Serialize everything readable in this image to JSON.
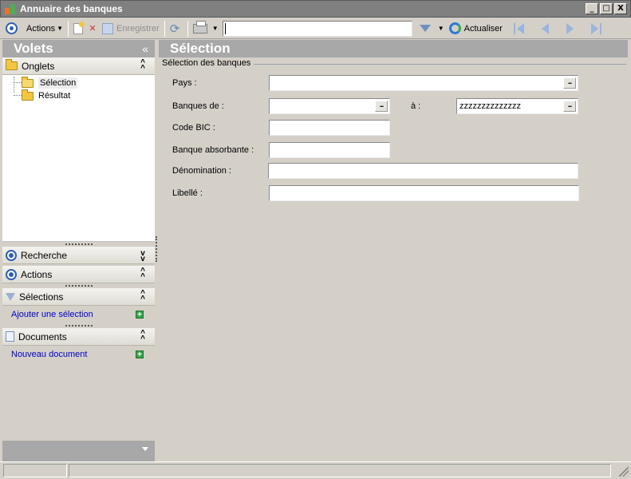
{
  "window": {
    "title": "Annuaire des banques",
    "controls": {
      "minimize": "_",
      "maximize": "□",
      "close": "X"
    }
  },
  "toolbar": {
    "actions_label": "Actions",
    "save_label": "Enregistrer",
    "search_value": "",
    "refresh_label": "Actualiser"
  },
  "left_pane": {
    "title": "Volets",
    "collapse_glyph": "«",
    "onglets": {
      "label": "Onglets",
      "items": [
        {
          "label": "Sélection",
          "selected": true
        },
        {
          "label": "Résultat",
          "selected": false
        }
      ]
    },
    "recherche": {
      "label": "Recherche"
    },
    "actions": {
      "label": "Actions"
    },
    "selections": {
      "label": "Sélections",
      "link": "Ajouter une sélection"
    },
    "documents": {
      "label": "Documents",
      "link": "Nouveau document"
    }
  },
  "right_pane": {
    "title": "Sélection",
    "group_title": "Sélection des banques",
    "fields": {
      "pays": {
        "label": "Pays :",
        "value": ""
      },
      "banques_de": {
        "label": "Banques de :",
        "value": ""
      },
      "a": {
        "label": "à :",
        "value": "zzzzzzzzzzzzzz"
      },
      "code_bic": {
        "label": "Code BIC :",
        "value": ""
      },
      "banque_absorbante": {
        "label": "Banque absorbante :",
        "value": ""
      },
      "denomination": {
        "label": "Dénomination :",
        "value": ""
      },
      "libelle": {
        "label": "Libellé :",
        "value": ""
      }
    },
    "ellipsis_glyph": "..."
  },
  "colors": {
    "pane_header": "#a8a8a8",
    "link": "#0000c8",
    "accent_blue": "#2f5fb3"
  }
}
